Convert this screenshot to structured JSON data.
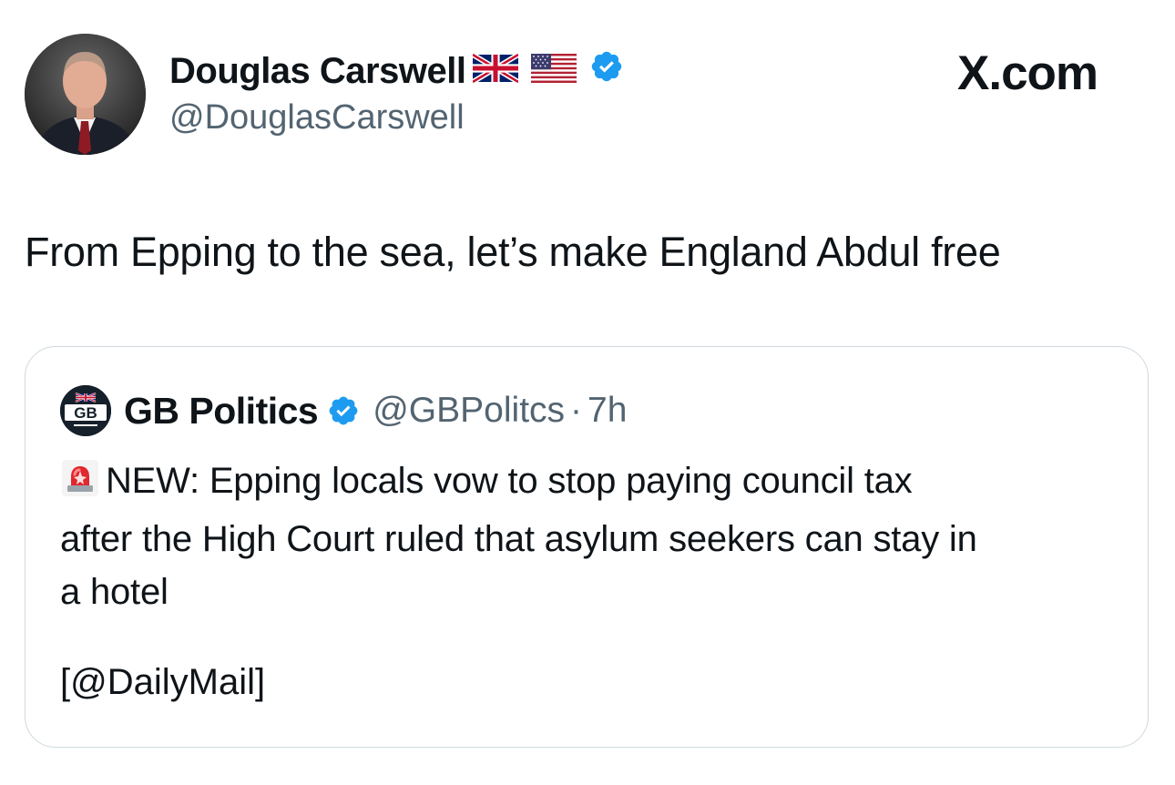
{
  "tweet": {
    "author": {
      "name": "Douglas Carswell",
      "handle": "@DouglasCarswell",
      "flag_icons": [
        "uk-flag-icon",
        "us-flag-icon"
      ],
      "verified_icon": "verified-badge-icon"
    },
    "brand": "X.com",
    "text": "From Epping to the sea, let’s make England Abdul free"
  },
  "quote": {
    "name": "GB Politics",
    "handle": "@GBPolitcs",
    "separator": "·",
    "time": "7h",
    "logo_text": "GB",
    "verified_icon": "verified-badge-icon",
    "lead_icon": "siren-icon",
    "lines": [
      "NEW: Epping locals vow to stop paying council tax",
      "after the High Court ruled that asylum seekers can stay in",
      "a hotel"
    ],
    "source": "[@DailyMail]"
  },
  "colors": {
    "text": "#0f1419",
    "secondary_text": "#536471",
    "verified_blue": "#1d9bf0",
    "border": "#cfd9de"
  }
}
